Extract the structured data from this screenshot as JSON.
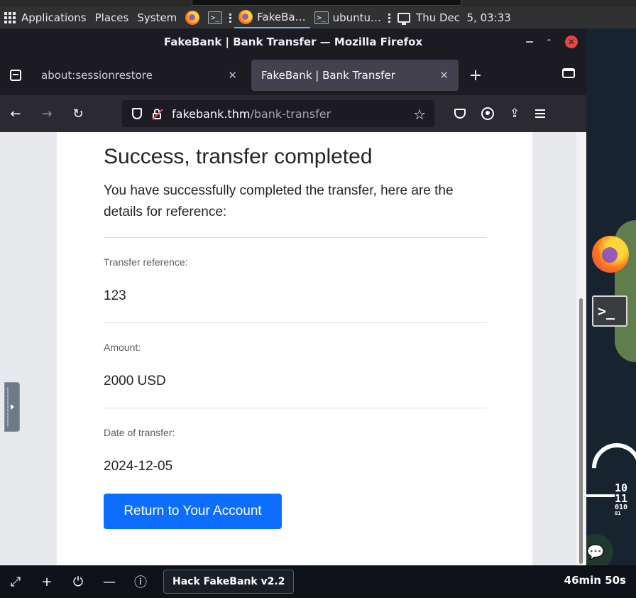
{
  "topbar": {
    "applications": "Applications",
    "places": "Places",
    "system": "System",
    "task_firefox": "FakeBa…",
    "task_terminal": "ubuntu…",
    "clock": "Thu Dec  5, 03:33"
  },
  "window": {
    "title": "FakeBank | Bank Transfer — Mozilla Firefox"
  },
  "tabs": [
    {
      "label": "about:sessionrestore"
    },
    {
      "label": "FakeBank | Bank Transfer"
    }
  ],
  "urlbar": {
    "host": "fakebank.thm",
    "path": "/bank-transfer"
  },
  "page": {
    "heading": "Success, transfer completed",
    "description": "You have successfully completed the transfer, here are the details for reference:",
    "fields": [
      {
        "label": "Transfer reference:",
        "value": "123"
      },
      {
        "label": "Amount:",
        "value": "2000 USD"
      },
      {
        "label": "Date of transfer:",
        "value": "2024-12-05"
      }
    ],
    "button": "Return to Your Account"
  },
  "desktop": {
    "terminal_glyph": ">_",
    "bin_line1": "10",
    "bin_line2": "11",
    "bin_line3": "010",
    "bin_line4": "01"
  },
  "bottombar": {
    "hack_button": "Hack FakeBank v2.2",
    "timer": "46min 50s"
  },
  "colors": {
    "accent": "#0d6efd",
    "close": "#e84545"
  }
}
